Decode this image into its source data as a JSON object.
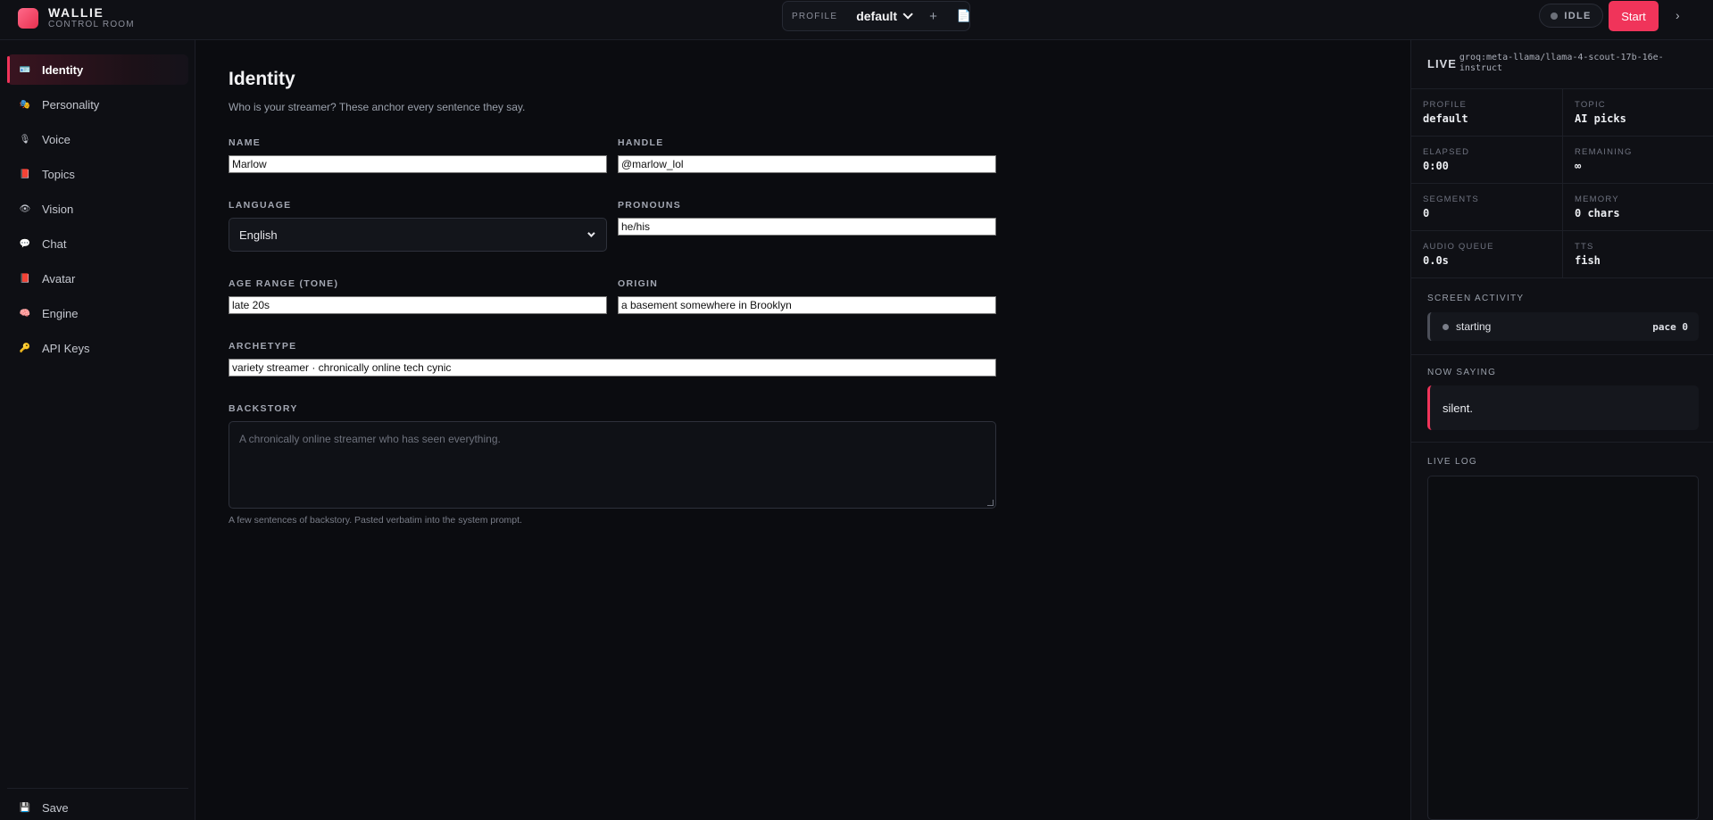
{
  "brand": {
    "title": "WALLIE",
    "subtitle": "CONTROL ROOM"
  },
  "profile_switcher": {
    "label": "PROFILE",
    "selected": "default",
    "add_icon": "+",
    "doc_icon": "📄"
  },
  "status": {
    "label": "IDLE"
  },
  "start_button": {
    "label": "Start"
  },
  "more_button": {
    "label": "›"
  },
  "sidebar": {
    "items": [
      {
        "label": "Identity",
        "icon": "🪪",
        "active": true
      },
      {
        "label": "Personality",
        "icon": "🎭"
      },
      {
        "label": "Voice",
        "icon": "🎙"
      },
      {
        "label": "Topics",
        "icon": "📕"
      },
      {
        "label": "Vision",
        "icon": "👁"
      },
      {
        "label": "Chat",
        "icon": "💬"
      },
      {
        "label": "Avatar",
        "icon": "📕"
      },
      {
        "label": "Engine",
        "icon": "🧠"
      },
      {
        "label": "API Keys",
        "icon": "🔑"
      }
    ],
    "save": {
      "label": "Save",
      "icon": "💾"
    }
  },
  "main": {
    "title": "Identity",
    "subtitle": "Who is your streamer? These anchor every sentence they say.",
    "fields": {
      "name": {
        "label": "NAME",
        "value": "Marlow"
      },
      "handle": {
        "label": "HANDLE",
        "value": "@marlow_lol"
      },
      "language": {
        "label": "LANGUAGE",
        "value": "English"
      },
      "pronouns": {
        "label": "PRONOUNS",
        "value": "he/his"
      },
      "age_range": {
        "label": "AGE RANGE (TONE)",
        "value": "late 20s"
      },
      "origin": {
        "label": "ORIGIN",
        "value": "a basement somewhere in Brooklyn"
      },
      "archetype": {
        "label": "ARCHETYPE",
        "value": "variety streamer · chronically online tech cynic"
      },
      "backstory": {
        "label": "BACKSTORY",
        "placeholder": "A chronically online streamer who has seen everything.",
        "hint": "A few sentences of backstory. Pasted verbatim into the system prompt."
      }
    }
  },
  "right_panel": {
    "live_label": "LIVE",
    "model": "groq:meta-llama/llama-4-scout-17b-16e-instruct",
    "stats": {
      "profile": {
        "label": "PROFILE",
        "value": "default"
      },
      "topic": {
        "label": "TOPIC",
        "value": "AI picks"
      },
      "elapsed": {
        "label": "ELAPSED",
        "value": "0:00"
      },
      "remaining": {
        "label": "REMAINING",
        "value": "∞"
      },
      "segments": {
        "label": "SEGMENTS",
        "value": "0"
      },
      "memory": {
        "label": "MEMORY",
        "value": "0 chars"
      },
      "audio_queue": {
        "label": "AUDIO QUEUE",
        "value": "0.0s"
      },
      "tts": {
        "label": "TTS",
        "value": "fish"
      }
    },
    "screen_activity": {
      "label": "SCREEN ACTIVITY",
      "status": "starting",
      "pace": "pace 0"
    },
    "now_saying": {
      "label": "NOW SAYING",
      "text": "silent."
    },
    "live_log": {
      "label": "LIVE LOG"
    }
  },
  "colors": {
    "accent": "#f0345a",
    "background": "#0b0c10",
    "panel": "#0f1015"
  }
}
